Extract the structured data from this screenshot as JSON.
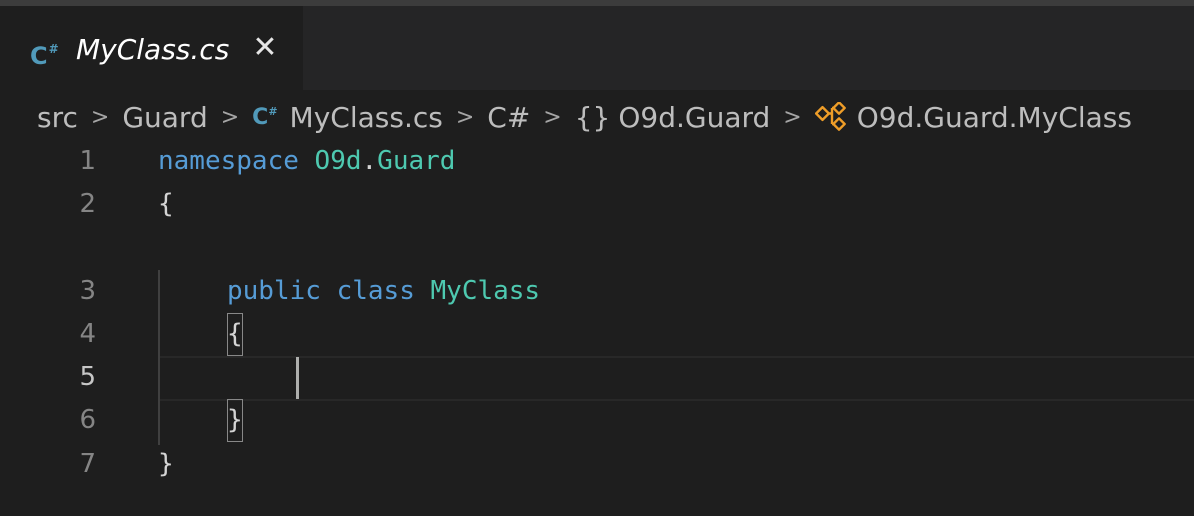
{
  "tab": {
    "icon": "csharp-file-icon",
    "icon_text": "C",
    "icon_sup": "#",
    "label": "MyClass.cs",
    "close_symbol": "✕"
  },
  "breadcrumb": {
    "items": [
      "src",
      "Guard",
      "MyClass.cs",
      "C#",
      "O9d.Guard",
      "O9d.Guard.MyClass"
    ],
    "separator": ">",
    "cs_icon_text": "C",
    "cs_icon_sup": "#",
    "namespace_icon_text": "{}",
    "class_icon": "class-symbol-icon"
  },
  "editor": {
    "line_numbers": [
      "1",
      "2",
      "3",
      "4",
      "5",
      "6",
      "7"
    ],
    "active_line": "5",
    "lines": {
      "l1": {
        "keyword": "namespace",
        "ns_first": "O9d",
        "dot": ".",
        "ns_second": "Guard"
      },
      "l2": {
        "brace": "{"
      },
      "l3": {
        "mod": "public",
        "keyword": "class",
        "name": "MyClass"
      },
      "l4": {
        "brace": "{"
      },
      "l6": {
        "brace": "}"
      },
      "l7": {
        "brace": "}"
      }
    }
  },
  "colors": {
    "background": "#1e1e1e",
    "keyword": "#569cd6",
    "type": "#4ec9b0",
    "text": "#d4d4d4",
    "csharp_icon": "#519aba",
    "class_icon": "#ee9d28"
  }
}
